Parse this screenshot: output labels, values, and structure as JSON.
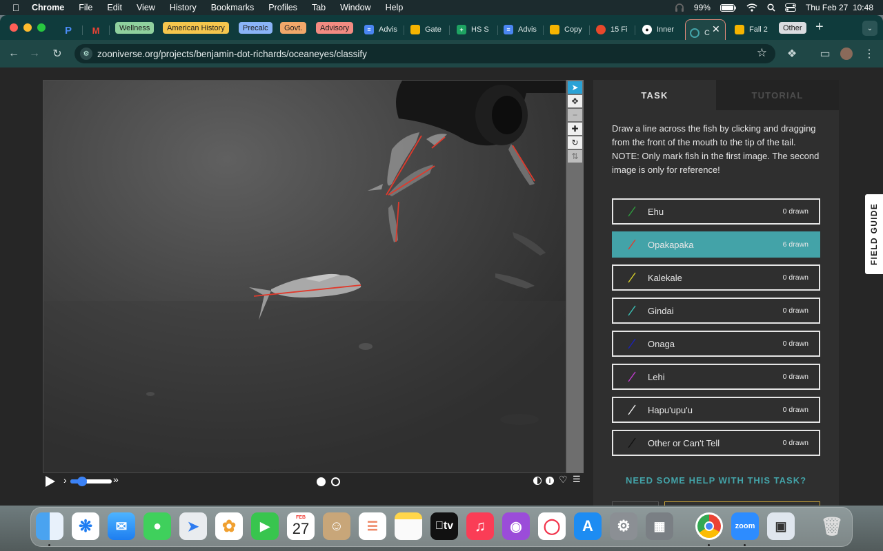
{
  "menubar": {
    "app_name": "Chrome",
    "items": [
      "File",
      "Edit",
      "View",
      "History",
      "Bookmarks",
      "Profiles",
      "Tab",
      "Window",
      "Help"
    ],
    "battery": "99%",
    "datetime": "Thu Feb 27  10:48"
  },
  "tabs": {
    "groups": [
      {
        "label": "Wellness",
        "color": "#8fd19e"
      },
      {
        "label": "American History",
        "color": "#f5c64d"
      },
      {
        "label": "Precalc",
        "color": "#8ab4f8"
      },
      {
        "label": "Govt.",
        "color": "#f1a86a"
      },
      {
        "label": "Advisory",
        "color": "#f28b82"
      },
      {
        "label": "Other",
        "color": "#dadce0"
      }
    ],
    "items": [
      {
        "label": "Advis",
        "icon": "docs-icon"
      },
      {
        "label": "Gate",
        "icon": "slides-icon"
      },
      {
        "label": "HS S",
        "icon": "sheets-icon"
      },
      {
        "label": "Advis",
        "icon": "docs-icon"
      },
      {
        "label": "Copy",
        "icon": "slides-icon"
      },
      {
        "label": "15 Fi",
        "icon": "flame-icon"
      },
      {
        "label": "Inner",
        "icon": "panda-icon"
      },
      {
        "label": "C",
        "icon": "zooniverse-icon"
      },
      {
        "label": "Fall 2",
        "icon": "slides-icon"
      }
    ]
  },
  "address_bar": {
    "url": "zooniverse.org/projects/benjamin-dot-richards/oceaneyes/classify"
  },
  "task_panel": {
    "tabs": {
      "task": "TASK",
      "tutorial": "TUTORIAL"
    },
    "instructions_1": "Draw a line across the fish by clicking and dragging from the front of the mouth to the tip of the tail.",
    "instructions_2": "NOTE: Only mark fish in the first image. The second image is only for reference!",
    "choices": [
      {
        "name": "Ehu",
        "count": "0 drawn",
        "color": "#2e9e3e"
      },
      {
        "name": "Opakapaka",
        "count": "6 drawn",
        "color": "#e03a2c"
      },
      {
        "name": "Kalekale",
        "count": "0 drawn",
        "color": "#d8d02a"
      },
      {
        "name": "Gindai",
        "count": "0 drawn",
        "color": "#3bc2b6"
      },
      {
        "name": "Onaga",
        "count": "0 drawn",
        "color": "#1c22b8"
      },
      {
        "name": "Lehi",
        "count": "0 drawn",
        "color": "#c23bd0"
      },
      {
        "name": "Hapu'upu'u",
        "count": "0 drawn",
        "color": "#f2f2f2"
      },
      {
        "name": "Other or Can't Tell",
        "count": "0 drawn",
        "color": "#111111"
      }
    ],
    "selected_choice": "Opakapaka",
    "help_link": "NEED SOME HELP WITH THIS TASK?"
  },
  "field_guide": "FIELD GUIDE",
  "subject_viewer": {
    "frames": 2,
    "current_frame": 1,
    "mark_color": "#e03a2c"
  },
  "dock": {
    "calendar_month": "FEB",
    "calendar_day": "27",
    "tv_label": "tv",
    "zoom_label": "zoom"
  }
}
